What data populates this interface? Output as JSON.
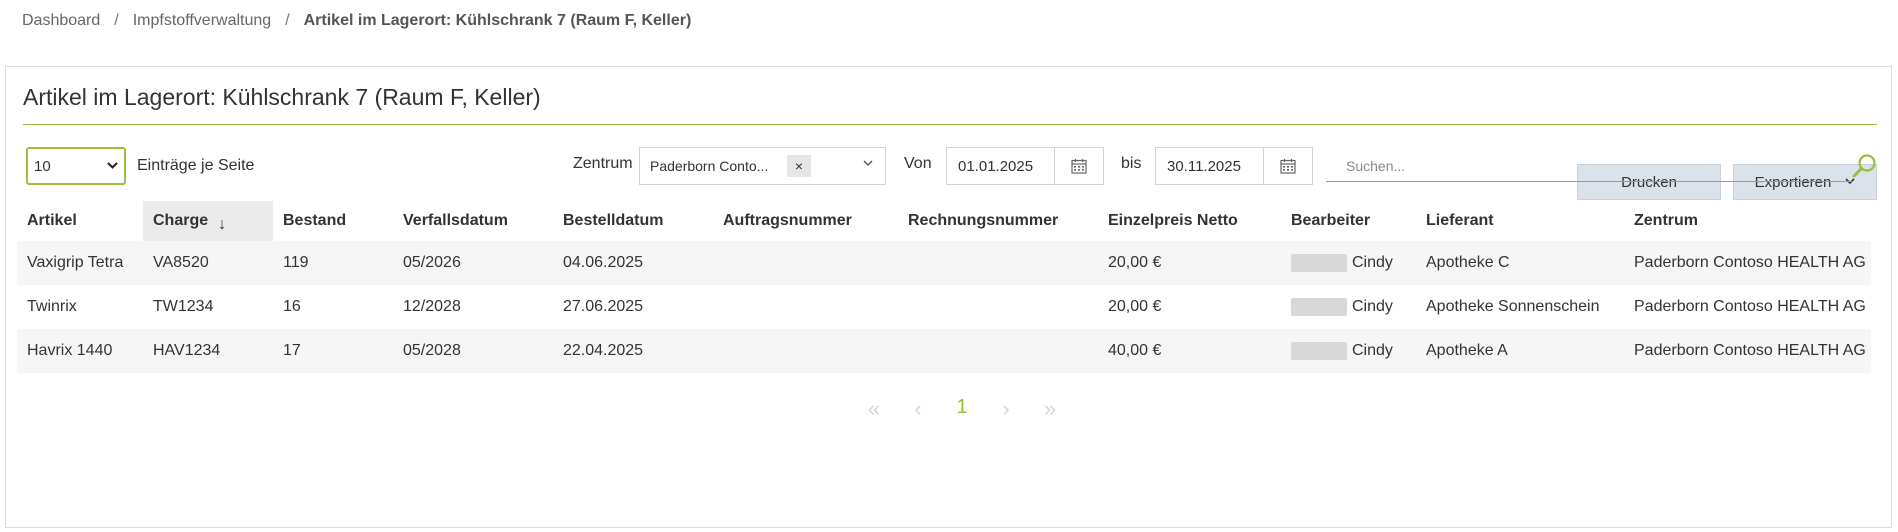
{
  "breadcrumb": {
    "items": [
      "Dashboard",
      "Impfstoffverwaltung"
    ],
    "current": "Artikel im Lagerort: Kühlschrank 7 (Raum F, Keller)",
    "separator": "/"
  },
  "page": {
    "title": "Artikel im Lagerort: Kühlschrank 7 (Raum F, Keller)"
  },
  "toolbar": {
    "print_label": "Drucken",
    "export_label": "Exportieren"
  },
  "filters": {
    "page_size_value": "10",
    "page_size_label": "Einträge je Seite",
    "zentrum_label": "Zentrum",
    "zentrum_value": "Paderborn Conto...",
    "von_label": "Von",
    "von_value": "01.01.2025",
    "bis_label": "bis",
    "bis_value": "30.11.2025",
    "search_placeholder": "Suchen..."
  },
  "table": {
    "columns": [
      "Artikel",
      "Charge",
      "Bestand",
      "Verfallsdatum",
      "Bestelldatum",
      "Auftragsnummer",
      "Rechnungsnummer",
      "Einzelpreis Netto",
      "Bearbeiter",
      "Lieferant",
      "Zentrum"
    ],
    "sorted_column": "Charge",
    "sort_direction": "descending",
    "rows": [
      {
        "artikel": "Vaxigrip Tetra",
        "charge": "VA8520",
        "bestand": "119",
        "verfallsdatum": "05/2026",
        "bestelldatum": "04.06.2025",
        "auftragsnummer": "",
        "rechnungsnummer": "",
        "einzelpreis": "20,00 €",
        "bearbeiter": "Cindy",
        "lieferant": "Apotheke C",
        "zentrum": "Paderborn Contoso HEALTH AG"
      },
      {
        "artikel": "Twinrix",
        "charge": "TW1234",
        "bestand": "16",
        "verfallsdatum": "12/2028",
        "bestelldatum": "27.06.2025",
        "auftragsnummer": "",
        "rechnungsnummer": "",
        "einzelpreis": "20,00 €",
        "bearbeiter": "Cindy",
        "lieferant": "Apotheke Sonnenschein",
        "zentrum": "Paderborn Contoso HEALTH AG"
      },
      {
        "artikel": "Havrix 1440",
        "charge": "HAV1234",
        "bestand": "17",
        "verfallsdatum": "05/2028",
        "bestelldatum": "22.04.2025",
        "auftragsnummer": "",
        "rechnungsnummer": "",
        "einzelpreis": "40,00 €",
        "bearbeiter": "Cindy",
        "lieferant": "Apotheke A",
        "zentrum": "Paderborn Contoso HEALTH AG"
      }
    ]
  },
  "pagination": {
    "first": "«",
    "prev": "‹",
    "current": "1",
    "next": "›",
    "last": "»"
  },
  "colors": {
    "accent": "#9bbd3c",
    "button_bg": "#dbe2ea"
  }
}
